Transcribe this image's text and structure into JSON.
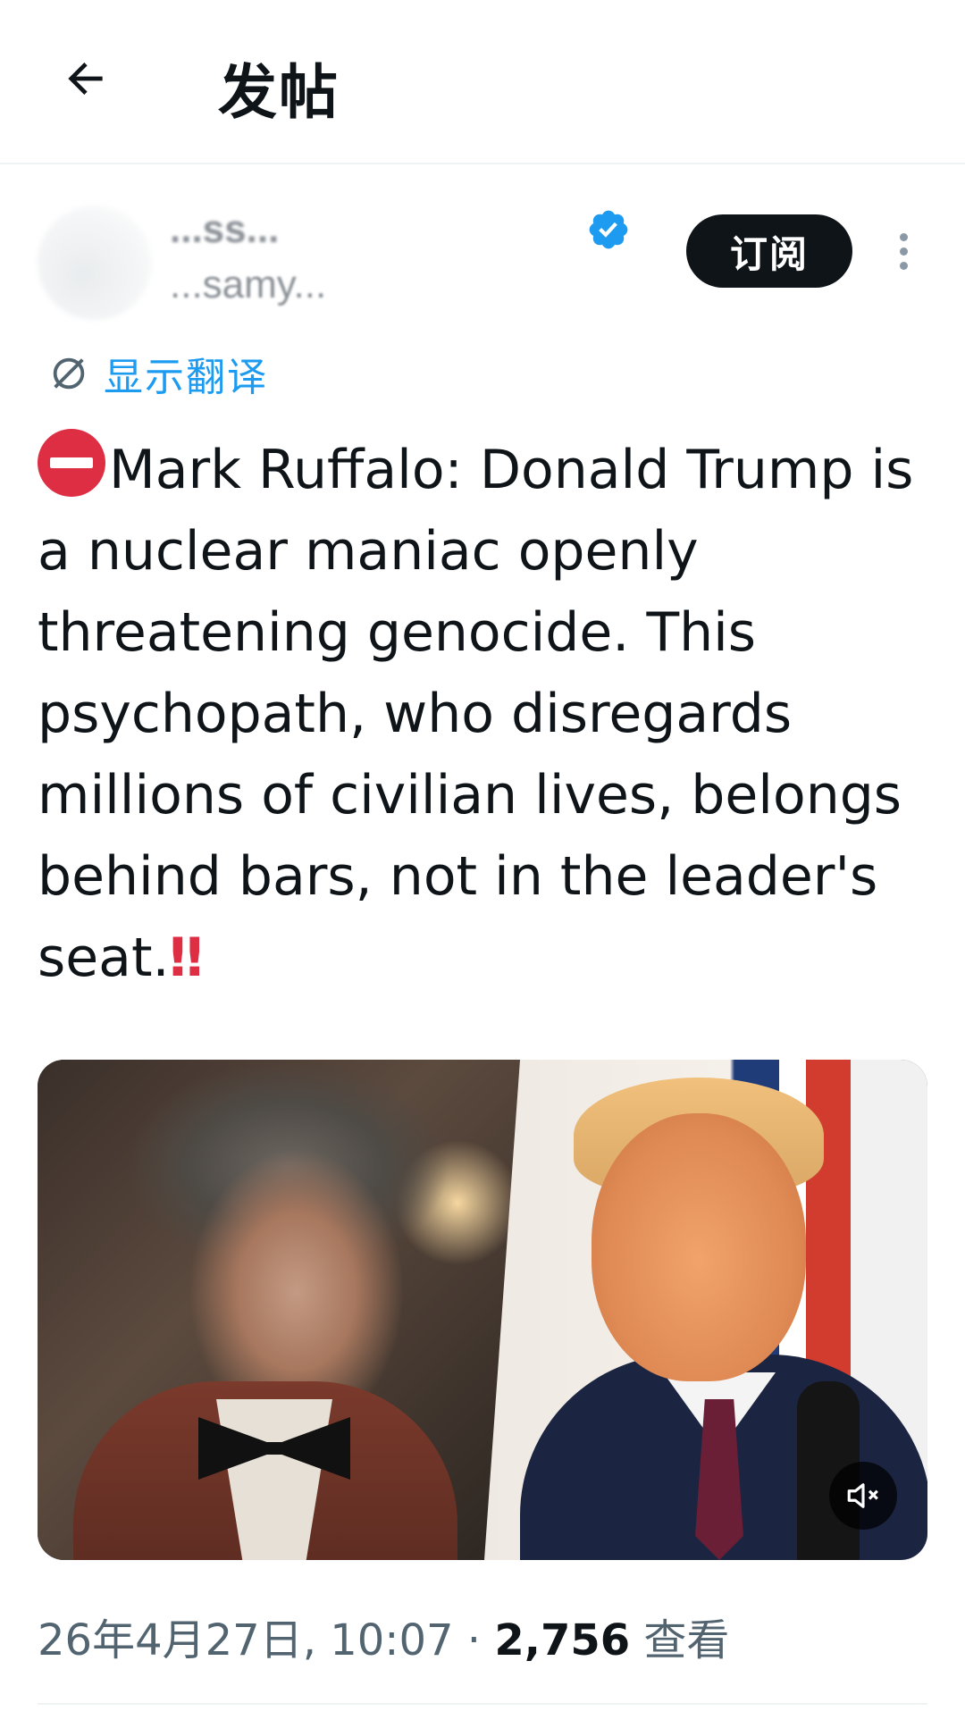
{
  "header": {
    "title": "发帖"
  },
  "author": {
    "display_name": "...ss...",
    "handle": "...samy..."
  },
  "actions": {
    "subscribe_label": "订阅"
  },
  "translate": {
    "label": "显示翻译"
  },
  "tweet": {
    "text": "Mark Ruffalo: Donald Trump is a nuclear maniac openly threatening genocide. This psychopath, who disregards millions of civilian lives, belongs behind bars, not in the leader's seat.",
    "end_emoji": "‼"
  },
  "meta": {
    "timestamp": "26年4月27日, 10:07 · ",
    "view_count": "2,756",
    "view_label": " 查看"
  },
  "icons": [
    "back-arrow-icon",
    "verified-badge-icon",
    "more-options-icon",
    "translate-icon",
    "no-entry-icon",
    "muted-speaker-icon"
  ],
  "colors": {
    "accent": "#1d9bf0",
    "text_primary": "#0f1419",
    "text_secondary": "#536471",
    "button_dark": "#0f1419"
  }
}
